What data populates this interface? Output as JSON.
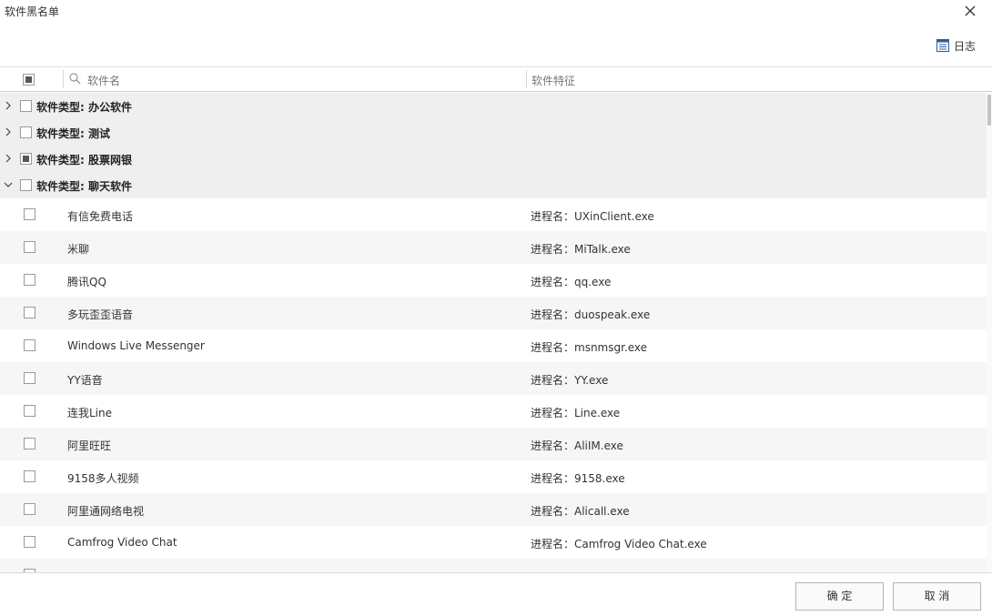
{
  "window": {
    "title": "软件黑名单",
    "close_icon": "close-icon"
  },
  "toolbar": {
    "log_label": "日志",
    "log_icon": "log-table-icon"
  },
  "table": {
    "columns": {
      "name": "软件名",
      "feature": "软件特征"
    },
    "groups": [
      {
        "label": "软件类型: 办公软件",
        "expanded": false,
        "check": "unchecked"
      },
      {
        "label": "软件类型: 测试",
        "expanded": false,
        "check": "unchecked"
      },
      {
        "label": "软件类型: 股票网银",
        "expanded": false,
        "check": "partial"
      },
      {
        "label": "软件类型: 聊天软件",
        "expanded": true,
        "check": "unchecked"
      }
    ],
    "items": [
      {
        "name": "有信免费电话",
        "feature": "进程名：UXinClient.exe"
      },
      {
        "name": "米聊",
        "feature": "进程名：MiTalk.exe"
      },
      {
        "name": "腾讯QQ",
        "feature": "进程名：qq.exe"
      },
      {
        "name": "多玩歪歪语音",
        "feature": "进程名：duospeak.exe"
      },
      {
        "name": "Windows Live Messenger",
        "feature": "进程名：msnmsgr.exe"
      },
      {
        "name": "YY语音",
        "feature": "进程名：YY.exe"
      },
      {
        "name": "连我Line",
        "feature": "进程名：Line.exe"
      },
      {
        "name": "阿里旺旺",
        "feature": "进程名：AliIM.exe"
      },
      {
        "name": "9158多人视频",
        "feature": "进程名：9158.exe"
      },
      {
        "name": "阿里通网络电视",
        "feature": "进程名：Alicall.exe"
      },
      {
        "name": "Camfrog Video Chat",
        "feature": "进程名：Camfrog Video Chat.exe"
      }
    ]
  },
  "footer": {
    "ok_label": "确 定",
    "cancel_label": "取 消"
  }
}
